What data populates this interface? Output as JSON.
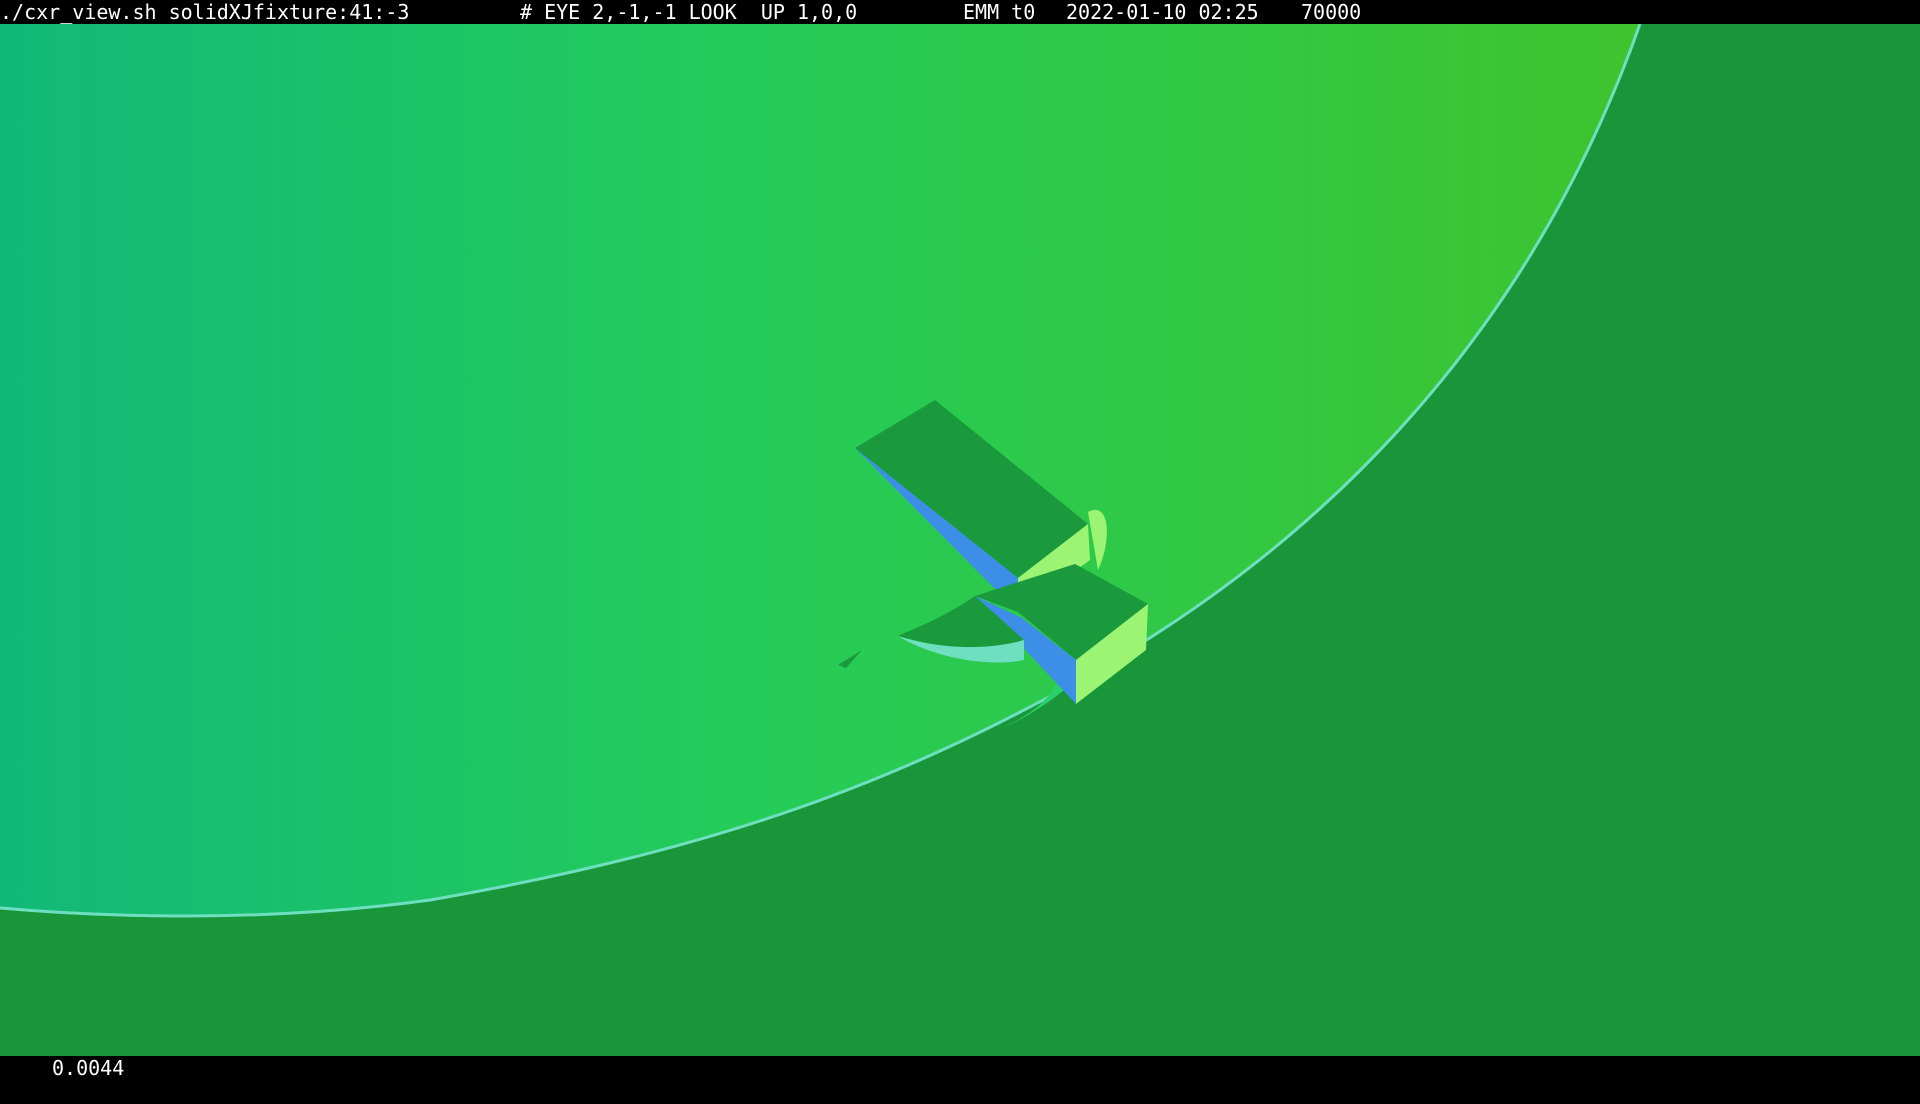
{
  "header": {
    "command": "./cxr_view.sh solidXJfixture:41:-3",
    "camera": "# EYE 2,-1,-1 LOOK  UP 1,0,0",
    "mode": "EMM t0",
    "datetime": "2022-01-10 02:25",
    "count": "70000"
  },
  "footer": {
    "value": "0.0044"
  },
  "scene": {
    "background_color": "#19963a",
    "sphere_colors": [
      "#12b878",
      "#24cc5a",
      "#3ec42e"
    ],
    "edge_color": "#6ee0c0",
    "box_top_color": "#1a9a3c",
    "box_side_color": "#3c8ee6",
    "box_end_color": "#9cf474",
    "icons": [
      "solid-box-shape",
      "sphere-shape"
    ]
  }
}
